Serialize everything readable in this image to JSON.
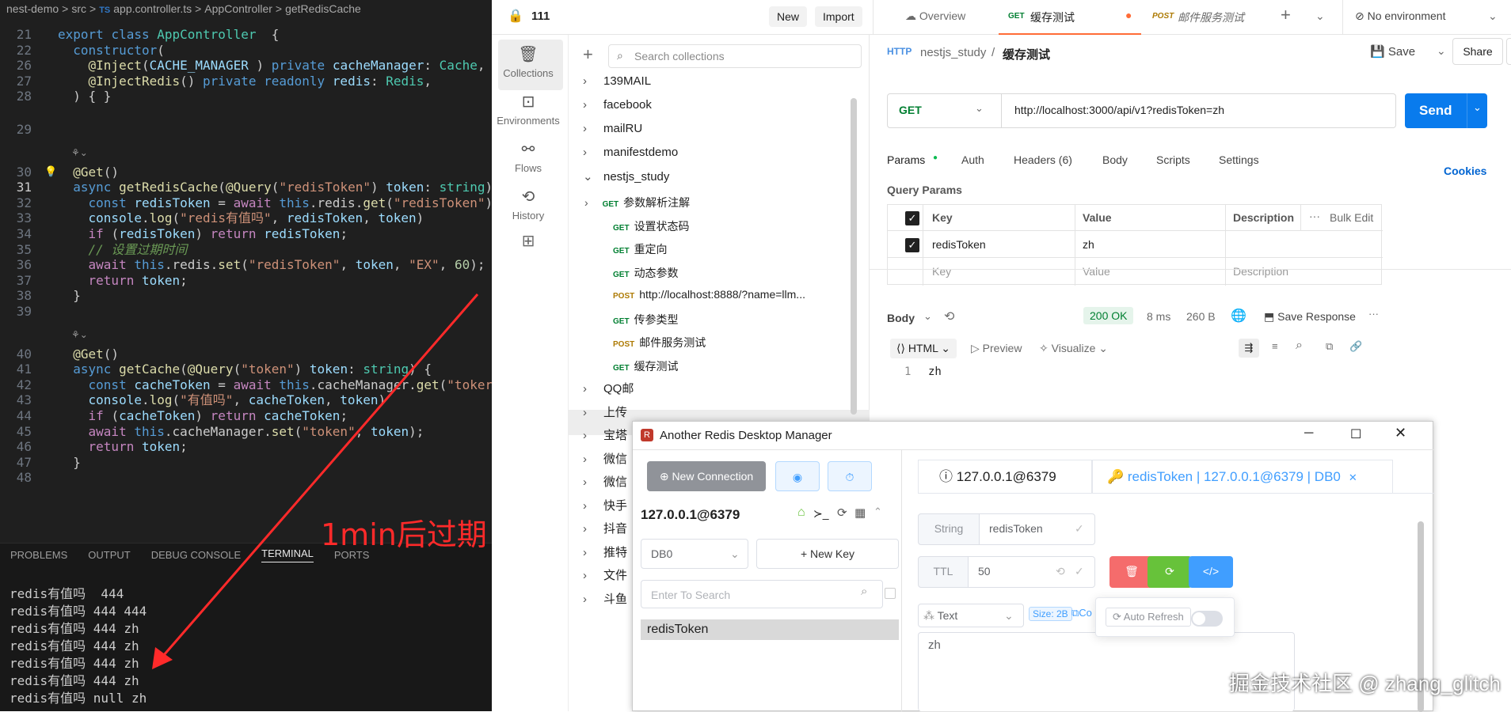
{
  "vscode": {
    "breadcrumb": [
      "nest-demo",
      ">",
      "src",
      ">",
      "TS",
      "app.controller.ts",
      ">",
      "AppController",
      ">",
      "getRedisCache"
    ],
    "lines": [
      {
        "n": "21",
        "code": [
          [
            "kw",
            "export "
          ],
          [
            "kw",
            "class "
          ],
          [
            "ty",
            "AppController"
          ],
          [
            "",
            "  {"
          ]
        ]
      },
      {
        "n": "22",
        "code": [
          [
            "",
            "  "
          ],
          [
            "kw",
            "constructor"
          ],
          [
            "",
            "("
          ]
        ]
      },
      {
        "n": "26",
        "code": [
          [
            "",
            "    "
          ],
          [
            "dc",
            "@Inject"
          ],
          [
            "",
            "("
          ],
          [
            "vr",
            "CACHE_MANAGER"
          ],
          [
            "",
            " ) "
          ],
          [
            "kw",
            "private "
          ],
          [
            "vr",
            "cacheManager"
          ],
          [
            "",
            ": "
          ],
          [
            "ty",
            "Cache"
          ],
          [
            "",
            ","
          ]
        ]
      },
      {
        "n": "27",
        "code": [
          [
            "",
            "    "
          ],
          [
            "dc",
            "@InjectRedis"
          ],
          [
            "",
            "() "
          ],
          [
            "kw",
            "private "
          ],
          [
            "kw",
            "readonly "
          ],
          [
            "vr",
            "redis"
          ],
          [
            "",
            ": "
          ],
          [
            "ty",
            "Redis"
          ],
          [
            "",
            ","
          ]
        ]
      },
      {
        "n": "28",
        "code": [
          [
            "",
            "  ) { }"
          ]
        ]
      },
      {
        "n": "29",
        "code": [
          [
            "",
            ""
          ]
        ]
      },
      {
        "n": "30",
        "code": [
          [
            "",
            "  "
          ],
          [
            "dc",
            "@Get"
          ],
          [
            "",
            "()"
          ]
        ]
      },
      {
        "n": "31",
        "code": [
          [
            "",
            "  "
          ],
          [
            "kw",
            "async "
          ],
          [
            "fn",
            "getRedisCache"
          ],
          [
            "",
            "("
          ],
          [
            "dc",
            "@Query"
          ],
          [
            "",
            "("
          ],
          [
            "st",
            "\"redisToken\""
          ],
          [
            "",
            ") "
          ],
          [
            "vr",
            "token"
          ],
          [
            "",
            ": "
          ],
          [
            "ty",
            "string"
          ],
          [
            "",
            ")"
          ]
        ]
      },
      {
        "n": "32",
        "code": [
          [
            "",
            "    "
          ],
          [
            "kw",
            "const "
          ],
          [
            "vr",
            "redisToken"
          ],
          [
            "",
            " = "
          ],
          [
            "kc",
            "await "
          ],
          [
            "kw",
            "this"
          ],
          [
            "",
            ".redis."
          ],
          [
            "fn",
            "get"
          ],
          [
            "",
            "("
          ],
          [
            "st",
            "\"redisToken\""
          ],
          [
            "",
            ")"
          ]
        ]
      },
      {
        "n": "33",
        "code": [
          [
            "",
            "    "
          ],
          [
            "vr",
            "console"
          ],
          [
            "",
            "."
          ],
          [
            "fn",
            "log"
          ],
          [
            "",
            "("
          ],
          [
            "st",
            "\"redis有值吗\""
          ],
          [
            "",
            ", "
          ],
          [
            "vr",
            "redisToken"
          ],
          [
            "",
            ", "
          ],
          [
            "vr",
            "token"
          ],
          [
            "",
            ")"
          ]
        ]
      },
      {
        "n": "34",
        "code": [
          [
            "",
            "    "
          ],
          [
            "kc",
            "if "
          ],
          [
            "",
            "("
          ],
          [
            "vr",
            "redisToken"
          ],
          [
            "",
            ") "
          ],
          [
            "kc",
            "return "
          ],
          [
            "vr",
            "redisToken"
          ],
          [
            "",
            ";"
          ]
        ]
      },
      {
        "n": "35",
        "code": [
          [
            "",
            "    "
          ],
          [
            "cm",
            "// 设置过期时间"
          ]
        ]
      },
      {
        "n": "36",
        "code": [
          [
            "",
            "    "
          ],
          [
            "kc",
            "await "
          ],
          [
            "kw",
            "this"
          ],
          [
            "",
            ".redis."
          ],
          [
            "fn",
            "set"
          ],
          [
            "",
            "("
          ],
          [
            "st",
            "\"redisToken\""
          ],
          [
            "",
            ", "
          ],
          [
            "vr",
            "token"
          ],
          [
            "",
            ", "
          ],
          [
            "st",
            "\"EX\""
          ],
          [
            "",
            ", "
          ],
          [
            "nu",
            "60"
          ],
          [
            "",
            ");"
          ]
        ]
      },
      {
        "n": "37",
        "code": [
          [
            "",
            "    "
          ],
          [
            "kc",
            "return "
          ],
          [
            "vr",
            "token"
          ],
          [
            "",
            ";"
          ]
        ]
      },
      {
        "n": "38",
        "code": [
          [
            "",
            "  }"
          ]
        ]
      },
      {
        "n": "39",
        "code": [
          [
            "",
            ""
          ]
        ]
      },
      {
        "n": "40",
        "code": [
          [
            "",
            "  "
          ],
          [
            "dc",
            "@Get"
          ],
          [
            "",
            "()"
          ]
        ]
      },
      {
        "n": "41",
        "code": [
          [
            "",
            "  "
          ],
          [
            "kw",
            "async "
          ],
          [
            "fn",
            "getCache"
          ],
          [
            "",
            "("
          ],
          [
            "dc",
            "@Query"
          ],
          [
            "",
            "("
          ],
          [
            "st",
            "\"token\""
          ],
          [
            "",
            ") "
          ],
          [
            "vr",
            "token"
          ],
          [
            "",
            ": "
          ],
          [
            "ty",
            "string"
          ],
          [
            "",
            ") {"
          ]
        ]
      },
      {
        "n": "42",
        "code": [
          [
            "",
            "    "
          ],
          [
            "kw",
            "const "
          ],
          [
            "vr",
            "cacheToken"
          ],
          [
            "",
            " = "
          ],
          [
            "kc",
            "await "
          ],
          [
            "kw",
            "this"
          ],
          [
            "",
            ".cacheManager."
          ],
          [
            "fn",
            "get"
          ],
          [
            "",
            "("
          ],
          [
            "st",
            "\"toker"
          ]
        ]
      },
      {
        "n": "43",
        "code": [
          [
            "",
            "    "
          ],
          [
            "vr",
            "console"
          ],
          [
            "",
            "."
          ],
          [
            "fn",
            "log"
          ],
          [
            "",
            "("
          ],
          [
            "st",
            "\"有值吗\""
          ],
          [
            "",
            ", "
          ],
          [
            "vr",
            "cacheToken"
          ],
          [
            "",
            ", "
          ],
          [
            "vr",
            "token"
          ],
          [
            "",
            ")"
          ]
        ]
      },
      {
        "n": "44",
        "code": [
          [
            "",
            "    "
          ],
          [
            "kc",
            "if "
          ],
          [
            "",
            "("
          ],
          [
            "vr",
            "cacheToken"
          ],
          [
            "",
            ") "
          ],
          [
            "kc",
            "return "
          ],
          [
            "vr",
            "cacheToken"
          ],
          [
            "",
            ";"
          ]
        ]
      },
      {
        "n": "45",
        "code": [
          [
            "",
            "    "
          ],
          [
            "kc",
            "await "
          ],
          [
            "kw",
            "this"
          ],
          [
            "",
            ".cacheManager."
          ],
          [
            "fn",
            "set"
          ],
          [
            "",
            "("
          ],
          [
            "st",
            "\"token\""
          ],
          [
            "",
            ", "
          ],
          [
            "vr",
            "token"
          ],
          [
            "",
            ");"
          ]
        ]
      },
      {
        "n": "46",
        "code": [
          [
            "",
            "    "
          ],
          [
            "kc",
            "return "
          ],
          [
            "vr",
            "token"
          ],
          [
            "",
            ";"
          ]
        ]
      },
      {
        "n": "47",
        "code": [
          [
            "",
            "  }"
          ]
        ]
      },
      {
        "n": "48",
        "code": [
          [
            "",
            ""
          ]
        ]
      }
    ],
    "panel_tabs": [
      "PROBLEMS",
      "OUTPUT",
      "DEBUG CONSOLE",
      "TERMINAL",
      "PORTS"
    ],
    "terminal": [
      "redis有值吗  444",
      "redis有值吗 444 444",
      "redis有值吗 444 zh",
      "redis有值吗 444 zh",
      "redis有值吗 444 zh",
      "redis有值吗 444 zh",
      "redis有值吗 null zh"
    ],
    "annotation": "1min后过期"
  },
  "postman": {
    "workspace": "111",
    "new_btn": "New",
    "import_btn": "Import",
    "tabs": {
      "overview": "Overview",
      "active_method": "GET",
      "active": "缓存测试",
      "post_method": "POST",
      "post": "邮件服务测试",
      "env": "No environment"
    },
    "rail": [
      "Collections",
      "Environments",
      "Flows",
      "History"
    ],
    "search_placeholder": "Search collections",
    "collections": [
      "139MAIL",
      "facebook",
      "mailRU",
      "manifestdemo",
      "nestjs_study"
    ],
    "requests": [
      {
        "m": "GET",
        "t": "参数解析注解",
        "sub": true
      },
      {
        "m": "GET",
        "t": "设置状态码"
      },
      {
        "m": "GET",
        "t": "重定向"
      },
      {
        "m": "GET",
        "t": "动态参数"
      },
      {
        "m": "POST",
        "t": "http://localhost:8888/?name=llm..."
      },
      {
        "m": "GET",
        "t": "传参类型"
      },
      {
        "m": "POST",
        "t": "邮件服务测试"
      },
      {
        "m": "GET",
        "t": "缓存测试"
      }
    ],
    "more_collections": [
      "QQ邮",
      "上传",
      "宝塔",
      "微信",
      "微信",
      "快手",
      "抖音",
      "推特",
      "文件",
      "斗鱼"
    ],
    "req_path": {
      "coll": "nestjs_study",
      "sep": "/",
      "name": "缓存测试"
    },
    "save": "Save",
    "share": "Share",
    "method": "GET",
    "url": "http://localhost:3000/api/v1?redisToken=zh",
    "send": "Send",
    "req_tabs": [
      "Params",
      "Auth",
      "Headers (6)",
      "Body",
      "Scripts",
      "Settings"
    ],
    "cookies": "Cookies",
    "query_params": "Query Params",
    "table_head": [
      "Key",
      "Value",
      "Description",
      "Bulk Edit"
    ],
    "row": {
      "key": "redisToken",
      "value": "zh"
    },
    "placeholders": {
      "key": "Key",
      "value": "Value",
      "desc": "Description"
    },
    "response": {
      "body": "Body",
      "status": "200 OK",
      "time": "8 ms",
      "size": "260 B",
      "save": "Save Response",
      "format": "HTML",
      "preview": "Preview",
      "visualize": "Visualize",
      "line": "1",
      "content": "zh"
    }
  },
  "rdm": {
    "title": "Another Redis Desktop Manager",
    "new_conn": "New Connection",
    "conn": "127.0.0.1@6379",
    "db": "DB0",
    "new_key": "New Key",
    "search_placeholder": "Enter To Search",
    "key_item": "redisToken",
    "tab1": "127.0.0.1@6379",
    "tab2": "redisToken | 127.0.0.1@6379 | DB0",
    "type": "String",
    "key": "redisToken",
    "ttl_label": "TTL",
    "ttl": "50",
    "view": "Text",
    "size": "Size: 2B",
    "copy": "Co",
    "auto_refresh": "Auto Refresh",
    "value": "zh",
    "accent": "#409eff"
  },
  "watermark": "掘金技术社区 @ zhang_glitch"
}
